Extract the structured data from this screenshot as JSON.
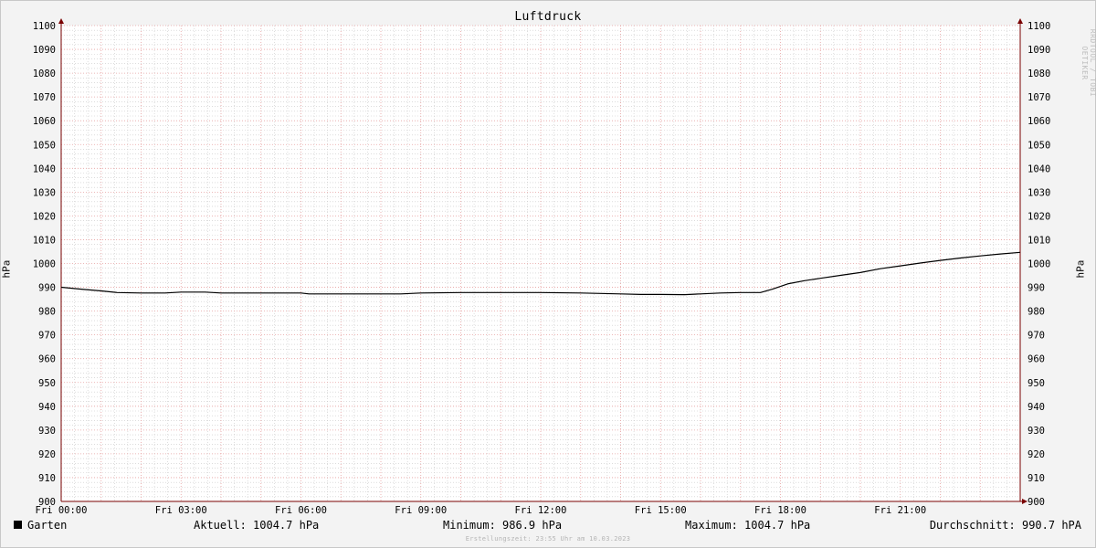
{
  "chart_data": {
    "type": "line",
    "title": "Luftdruck",
    "ylabel": "hPa",
    "ylim": [
      900,
      1100
    ],
    "ytick_step": 10,
    "xlim": [
      0,
      24
    ],
    "xticks": [
      {
        "x": 0,
        "label": "Fri 00:00"
      },
      {
        "x": 3,
        "label": "Fri 03:00"
      },
      {
        "x": 6,
        "label": "Fri 06:00"
      },
      {
        "x": 9,
        "label": "Fri 09:00"
      },
      {
        "x": 12,
        "label": "Fri 12:00"
      },
      {
        "x": 15,
        "label": "Fri 15:00"
      },
      {
        "x": 18,
        "label": "Fri 18:00"
      },
      {
        "x": 21,
        "label": "Fri 21:00"
      }
    ],
    "grid": true,
    "series": [
      {
        "name": "Garten",
        "color": "#000000",
        "points": [
          [
            0,
            990.0
          ],
          [
            0.5,
            989.2
          ],
          [
            1.0,
            988.5
          ],
          [
            1.4,
            987.8
          ],
          [
            2.0,
            987.6
          ],
          [
            2.6,
            987.6
          ],
          [
            3.0,
            988.0
          ],
          [
            3.6,
            988.0
          ],
          [
            4.0,
            987.6
          ],
          [
            5.0,
            987.6
          ],
          [
            6.0,
            987.6
          ],
          [
            6.2,
            987.2
          ],
          [
            7.0,
            987.2
          ],
          [
            8.0,
            987.2
          ],
          [
            8.5,
            987.2
          ],
          [
            9.0,
            987.6
          ],
          [
            10.0,
            987.8
          ],
          [
            11.0,
            987.8
          ],
          [
            12.0,
            987.8
          ],
          [
            13.0,
            987.6
          ],
          [
            14.0,
            987.2
          ],
          [
            14.5,
            987.0
          ],
          [
            15.0,
            987.0
          ],
          [
            15.6,
            986.9
          ],
          [
            16.0,
            987.2
          ],
          [
            16.5,
            987.6
          ],
          [
            17.0,
            987.8
          ],
          [
            17.5,
            987.8
          ],
          [
            17.8,
            989.2
          ],
          [
            18.2,
            991.5
          ],
          [
            18.6,
            992.8
          ],
          [
            19.0,
            993.8
          ],
          [
            19.5,
            995.0
          ],
          [
            20.0,
            996.2
          ],
          [
            20.5,
            997.8
          ],
          [
            21.0,
            999.0
          ],
          [
            21.5,
            1000.2
          ],
          [
            22.0,
            1001.3
          ],
          [
            22.5,
            1002.3
          ],
          [
            23.0,
            1003.2
          ],
          [
            23.5,
            1004.0
          ],
          [
            24.0,
            1004.7
          ]
        ]
      }
    ]
  },
  "legend": {
    "series_name": "Garten",
    "current": "Aktuell: 1004.7 hPa",
    "minimum": "Minimum: 986.9 hPa",
    "maximum": "Maximum: 1004.7 hPa",
    "average": "Durchschnitt: 990.7 hPA"
  },
  "watermark": "RRDTOOL / TOBI OETIKER",
  "footer": "Erstellungszeit: 23:55 Uhr am 10.03.2023",
  "colors": {
    "major_grid": "#e6a0a0",
    "minor_grid": "#c8c8c8",
    "axis": "#7a0000",
    "plot_bg": "#ffffff"
  }
}
